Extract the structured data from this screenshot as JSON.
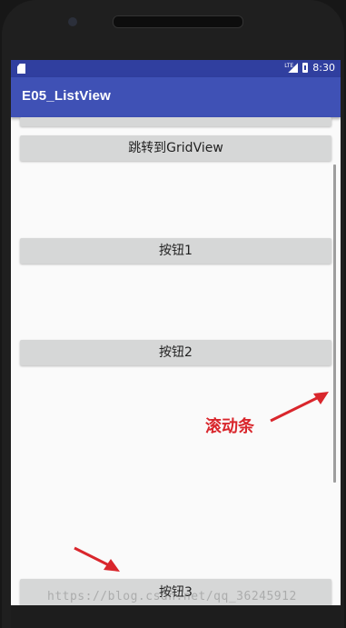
{
  "status_bar": {
    "network_label": "LTE",
    "time": "8:30"
  },
  "app_bar": {
    "title": "E05_ListView"
  },
  "buttons": {
    "gridview": "跳转到GridView",
    "button1": "按钮1",
    "button2": "按钮2",
    "button3": "按钮3"
  },
  "annotation": {
    "label": "滚动条",
    "color": "#d9262c"
  },
  "watermark": "https://blog.csdn.net/qq_36245912",
  "colors": {
    "status_bar": "#303f9f",
    "app_bar": "#3f51b5",
    "button": "#d6d7d7"
  }
}
